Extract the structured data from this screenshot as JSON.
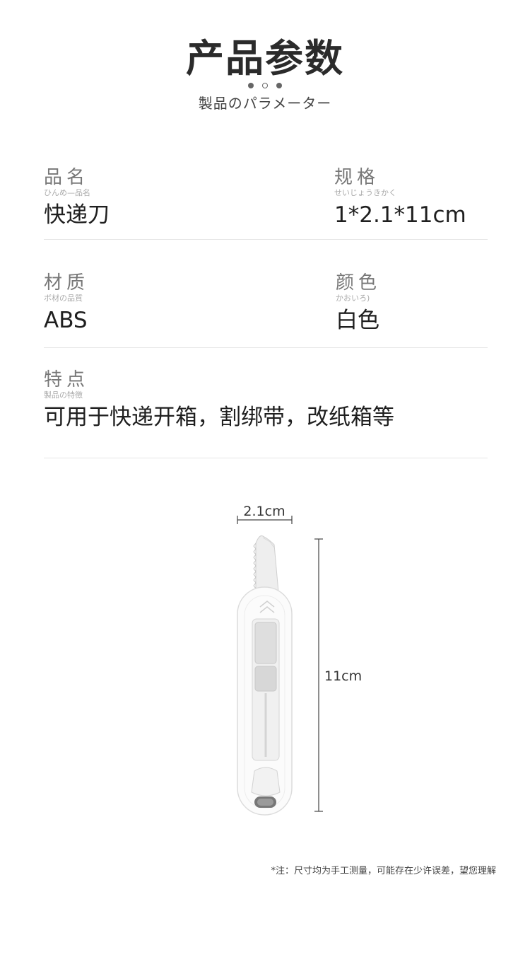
{
  "header": {
    "title": "产品参数",
    "subtitle": "製品のパラメーター"
  },
  "params": {
    "name": {
      "label": "品名",
      "kana": "ひんめ—品名",
      "value": "快递刀"
    },
    "spec": {
      "label": "规格",
      "kana": "せいじょうきかく",
      "value": "1*2.1*11cm"
    },
    "material": {
      "label": "材质",
      "kana": "ボ材の品質",
      "value": "ABS"
    },
    "color": {
      "label": "颜色",
      "kana": "かおいろ)",
      "value": "白色"
    },
    "feature": {
      "label": "特点",
      "kana": "製品の特徴",
      "value": "可用于快递开箱，割绑带，改纸箱等"
    }
  },
  "diagram": {
    "width_label": "2.1cm",
    "length_label": "11cm"
  },
  "footer": {
    "note": "*注：尺寸均为手工测量，可能存在少许误差，望您理解"
  }
}
